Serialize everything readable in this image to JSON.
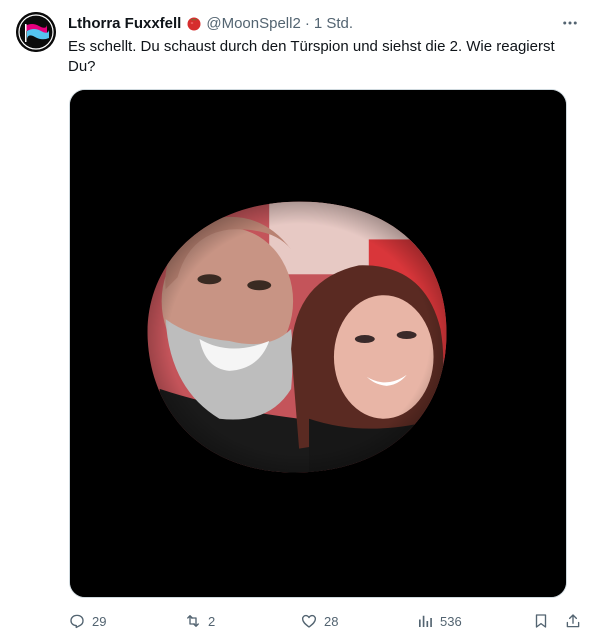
{
  "tweet": {
    "display_name": "Lthorra Fuxxfell",
    "handle": "@MoonSpell2",
    "separator": "·",
    "timestamp": "1 Std.",
    "text": "Es schellt. Du schaust durch den Türspion und siehst die 2. Wie reagierst Du?"
  },
  "avatar": {
    "icon": "antifa-flag-logo",
    "colors": [
      "#e6007e",
      "#55c4f0",
      "#ffffff",
      "#000000"
    ]
  },
  "badge": {
    "icon": "tomato-emoji",
    "color": "#d62d2d"
  },
  "media": {
    "description_icon": "circular-peephole-photo",
    "background": "#000000"
  },
  "actions": {
    "reply": {
      "icon": "reply-icon",
      "count": "29"
    },
    "retweet": {
      "icon": "retweet-icon",
      "count": "2"
    },
    "like": {
      "icon": "heart-icon",
      "count": "28"
    },
    "views": {
      "icon": "views-chart-icon",
      "count": "536"
    },
    "bookmark": {
      "icon": "bookmark-icon"
    },
    "share": {
      "icon": "share-icon"
    }
  },
  "colors": {
    "text_primary": "#0f1419",
    "text_secondary": "#536471",
    "border": "#cfd9de"
  }
}
